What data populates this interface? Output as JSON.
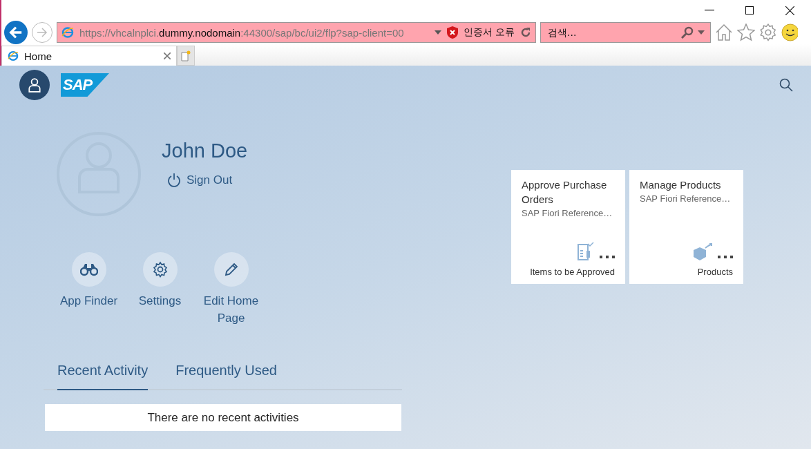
{
  "browser": {
    "address": {
      "parts": [
        {
          "text": "https://vhcalnplci.",
          "strong": false
        },
        {
          "text": "dummy.nodomain",
          "strong": true
        },
        {
          "text": ":44300/sap/bc/ui2/flp?sap-client=00",
          "strong": false
        }
      ]
    },
    "cert_error": "인증서 오류",
    "search": {
      "placeholder": "검색..."
    },
    "tabs": [
      {
        "label": "Home",
        "selected": true
      }
    ]
  },
  "shell": {
    "logo": "SAP"
  },
  "profile": {
    "name": "John Doe",
    "sign_out": "Sign Out"
  },
  "actions": [
    {
      "kind": "finder",
      "label": "App Finder"
    },
    {
      "kind": "settings",
      "label": "Settings"
    },
    {
      "kind": "edit",
      "label": "Edit Home Page"
    }
  ],
  "activity_tabs": [
    {
      "label": "Recent Activity",
      "selected": true
    },
    {
      "label": "Frequently Used",
      "selected": false
    }
  ],
  "empty_message": "There are no recent activities",
  "tiles": [
    {
      "kind": "approve",
      "title": "Approve Purchase Orders",
      "subtitle": "SAP Fiori Reference…",
      "footer": "Items to be Approved"
    },
    {
      "kind": "products",
      "title": "Manage Products",
      "subtitle": "SAP Fiori Reference…",
      "footer": "Products"
    }
  ]
}
